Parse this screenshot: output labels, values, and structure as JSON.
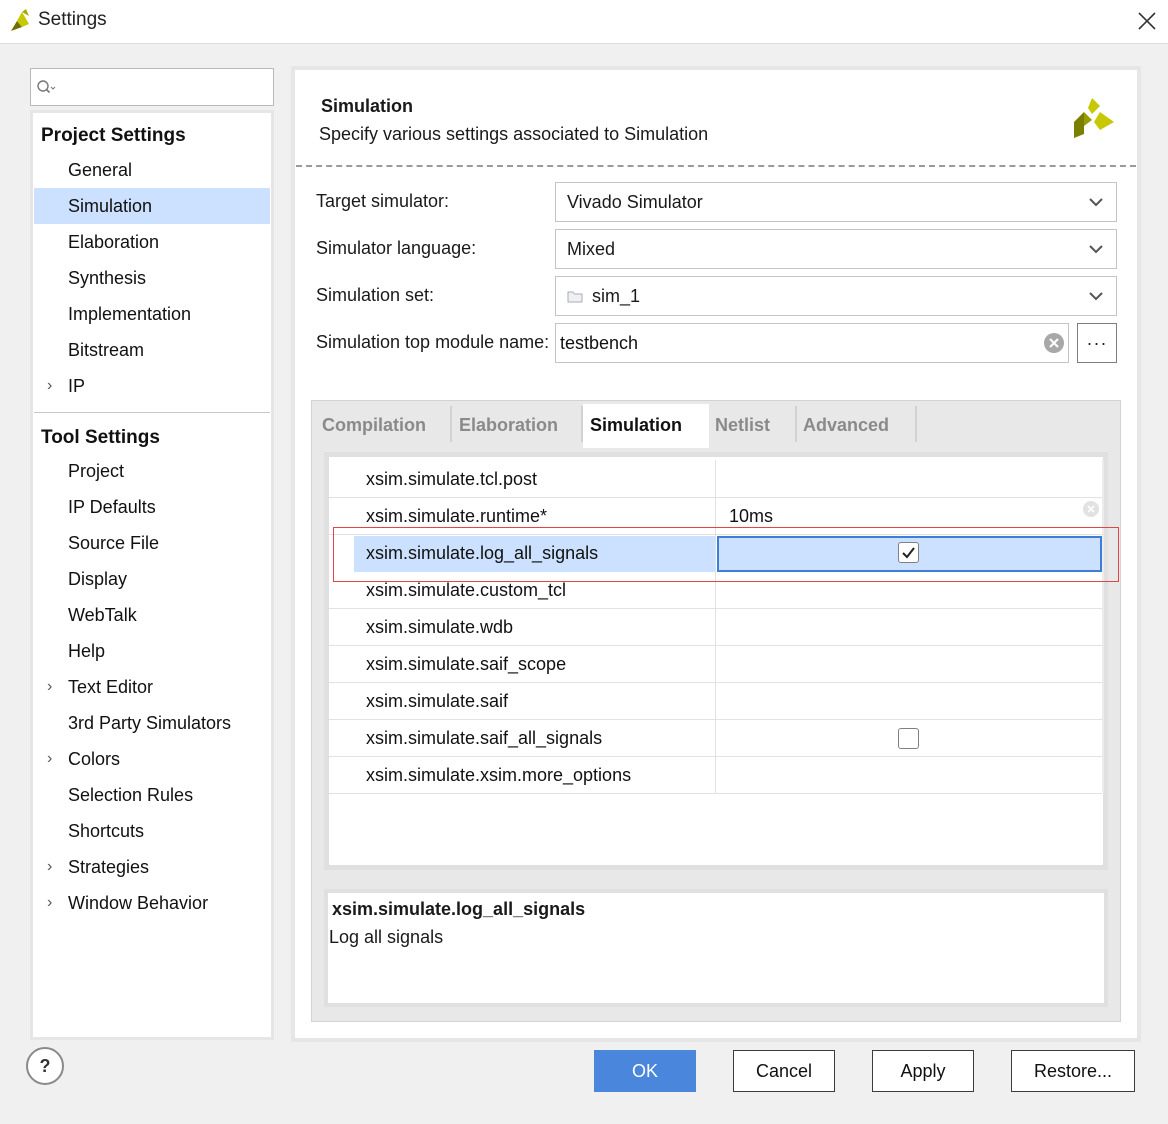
{
  "window": {
    "title": "Settings"
  },
  "search": {
    "placeholder": ""
  },
  "sidebar": {
    "project_heading": "Project Settings",
    "project_items": [
      {
        "label": "General"
      },
      {
        "label": "Simulation",
        "selected": true
      },
      {
        "label": "Elaboration"
      },
      {
        "label": "Synthesis"
      },
      {
        "label": "Implementation"
      },
      {
        "label": "Bitstream"
      },
      {
        "label": "IP",
        "expandable": true
      }
    ],
    "tool_heading": "Tool Settings",
    "tool_items": [
      {
        "label": "Project"
      },
      {
        "label": "IP Defaults"
      },
      {
        "label": "Source File"
      },
      {
        "label": "Display"
      },
      {
        "label": "WebTalk"
      },
      {
        "label": "Help"
      },
      {
        "label": "Text Editor",
        "expandable": true
      },
      {
        "label": "3rd Party Simulators"
      },
      {
        "label": "Colors",
        "expandable": true
      },
      {
        "label": "Selection Rules"
      },
      {
        "label": "Shortcuts"
      },
      {
        "label": "Strategies",
        "expandable": true
      },
      {
        "label": "Window Behavior",
        "expandable": true
      }
    ]
  },
  "header": {
    "title": "Simulation",
    "description": "Specify various settings associated to Simulation"
  },
  "form": {
    "target_simulator": {
      "label": "Target simulator:",
      "value": "Vivado Simulator"
    },
    "simulator_language": {
      "label": "Simulator language:",
      "value": "Mixed"
    },
    "simulation_set": {
      "label": "Simulation set:",
      "value": "sim_1"
    },
    "top_module": {
      "label": "Simulation top module name:",
      "value": "testbench",
      "browse_label": "···"
    }
  },
  "tabs": [
    {
      "label": "Compilation"
    },
    {
      "label": "Elaboration"
    },
    {
      "label": "Simulation",
      "active": true
    },
    {
      "label": "Netlist"
    },
    {
      "label": "Advanced"
    }
  ],
  "table": {
    "rows": [
      {
        "name": "xsim.simulate.tcl.post",
        "value": ""
      },
      {
        "name": "xsim.simulate.runtime*",
        "value": "10ms"
      },
      {
        "name": "xsim.simulate.log_all_signals",
        "checked": true,
        "selected": true
      },
      {
        "name": "xsim.simulate.custom_tcl",
        "value": ""
      },
      {
        "name": "xsim.simulate.wdb",
        "value": ""
      },
      {
        "name": "xsim.simulate.saif_scope",
        "value": ""
      },
      {
        "name": "xsim.simulate.saif",
        "value": ""
      },
      {
        "name": "xsim.simulate.saif_all_signals",
        "checked": false
      },
      {
        "name": "xsim.simulate.xsim.more_options",
        "value": ""
      }
    ]
  },
  "description_panel": {
    "title": "xsim.simulate.log_all_signals",
    "text": "Log all signals"
  },
  "footer": {
    "help_label": "?",
    "ok_label": "OK",
    "cancel_label": "Cancel",
    "apply_label": "Apply",
    "restore_label": "Restore..."
  },
  "colors": {
    "selection": "#cce0ff",
    "primary_button": "#4a86dc",
    "highlight_box": "#e04646",
    "logo_yellow": "#c8c800",
    "logo_dark": "#7b7f00"
  }
}
